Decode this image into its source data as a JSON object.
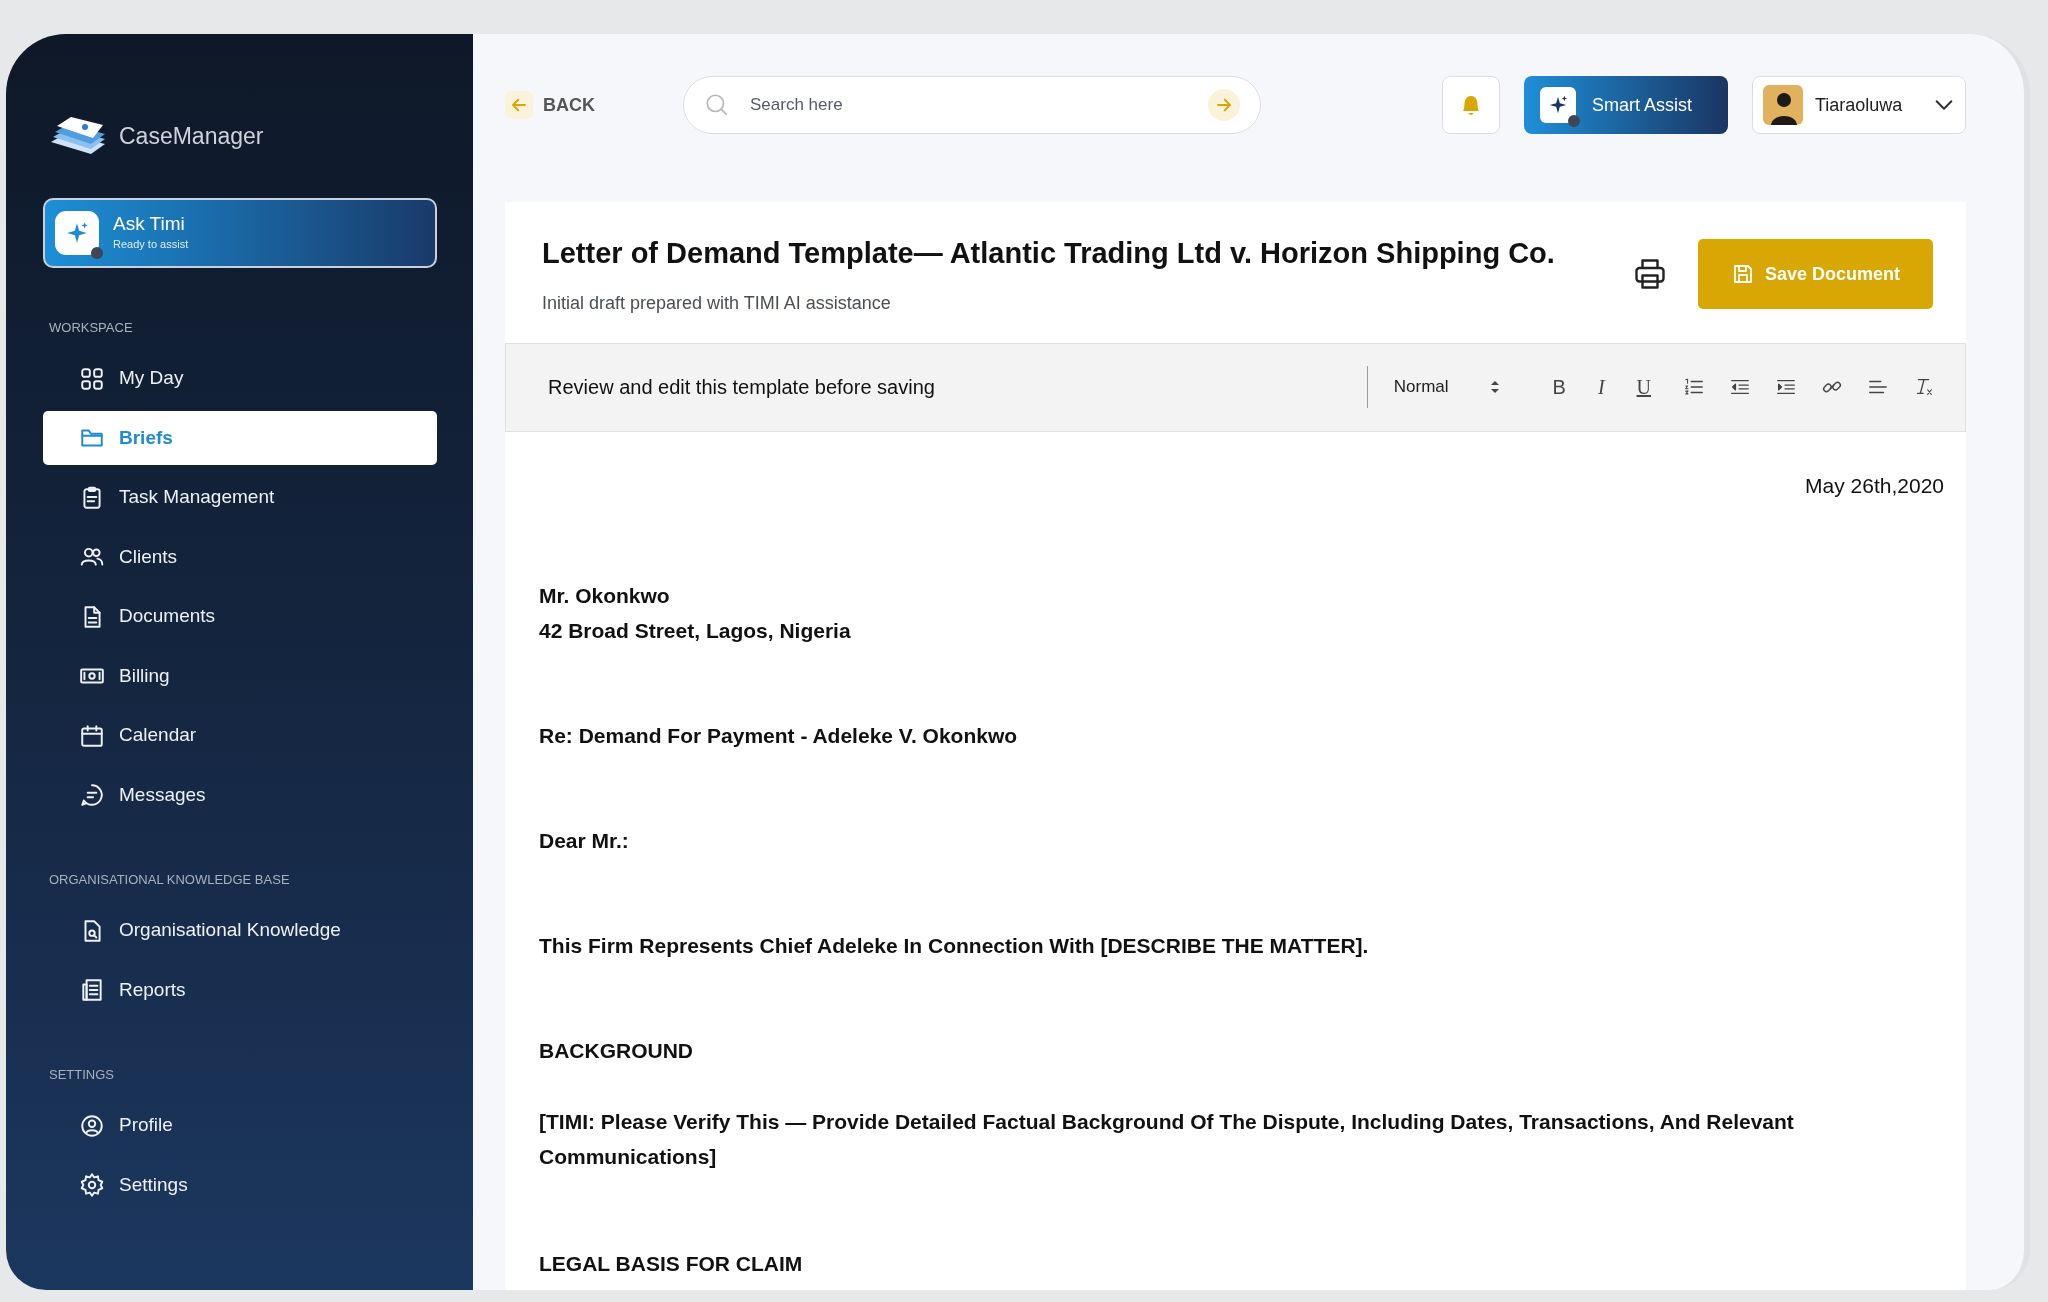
{
  "brand": {
    "name": "CaseManager"
  },
  "assistant_card": {
    "title": "Ask Timi",
    "subtitle": "Ready to assist"
  },
  "sidebar": {
    "sections": [
      {
        "heading": "WORKSPACE",
        "items": [
          {
            "label": "My Day",
            "selected": false
          },
          {
            "label": "Briefs",
            "selected": true
          },
          {
            "label": "Task Management",
            "selected": false
          },
          {
            "label": "Clients",
            "selected": false
          },
          {
            "label": "Documents",
            "selected": false
          },
          {
            "label": "Billing",
            "selected": false
          },
          {
            "label": "Calendar",
            "selected": false
          },
          {
            "label": "Messages",
            "selected": false
          }
        ]
      },
      {
        "heading": "ORGANISATIONAL KNOWLEDGE BASE",
        "items": [
          {
            "label": "Organisational Knowledge",
            "selected": false
          },
          {
            "label": "Reports",
            "selected": false
          }
        ]
      },
      {
        "heading": "SETTINGS",
        "items": [
          {
            "label": "Profile",
            "selected": false
          },
          {
            "label": "Settings",
            "selected": false
          }
        ]
      }
    ]
  },
  "header": {
    "back_label": "BACK",
    "search": {
      "placeholder": "Search here"
    },
    "smart_assist": "Smart Assist",
    "user": {
      "name": "Tiaraoluwa"
    }
  },
  "document": {
    "title": "Letter of Demand Template— Atlantic Trading Ltd v. Horizon Shipping Co.",
    "subtitle": "Initial draft prepared with TIMI AI assistance",
    "save_label": "Save Document",
    "toolbar": {
      "hint": "Review and edit this template before saving",
      "format": "Normal",
      "format_buttons": [
        "B",
        "I",
        "U"
      ]
    },
    "body": [
      {
        "kind": "date",
        "lines": [
          "May 26th,2020"
        ]
      },
      {
        "kind": "para",
        "lines": [
          "Mr. Okonkwo",
          "42 Broad Street, Lagos, Nigeria"
        ]
      },
      {
        "kind": "para",
        "lines": [
          "Re: Demand For Payment - Adeleke V. Okonkwo"
        ]
      },
      {
        "kind": "para",
        "lines": [
          "Dear Mr.:"
        ]
      },
      {
        "kind": "para",
        "lines": [
          "This Firm Represents Chief Adeleke In Connection With [DESCRIBE THE MATTER]."
        ]
      },
      {
        "kind": "heading",
        "lines": [
          "BACKGROUND"
        ]
      },
      {
        "kind": "note",
        "lines": [
          "[TIMI: Please Verify This — Provide Detailed Factual Background Of The Dispute, Including Dates, Transactions, And Relevant Communications]"
        ]
      },
      {
        "kind": "heading",
        "lines": [
          "LEGAL BASIS FOR CLAIM"
        ]
      }
    ]
  }
}
